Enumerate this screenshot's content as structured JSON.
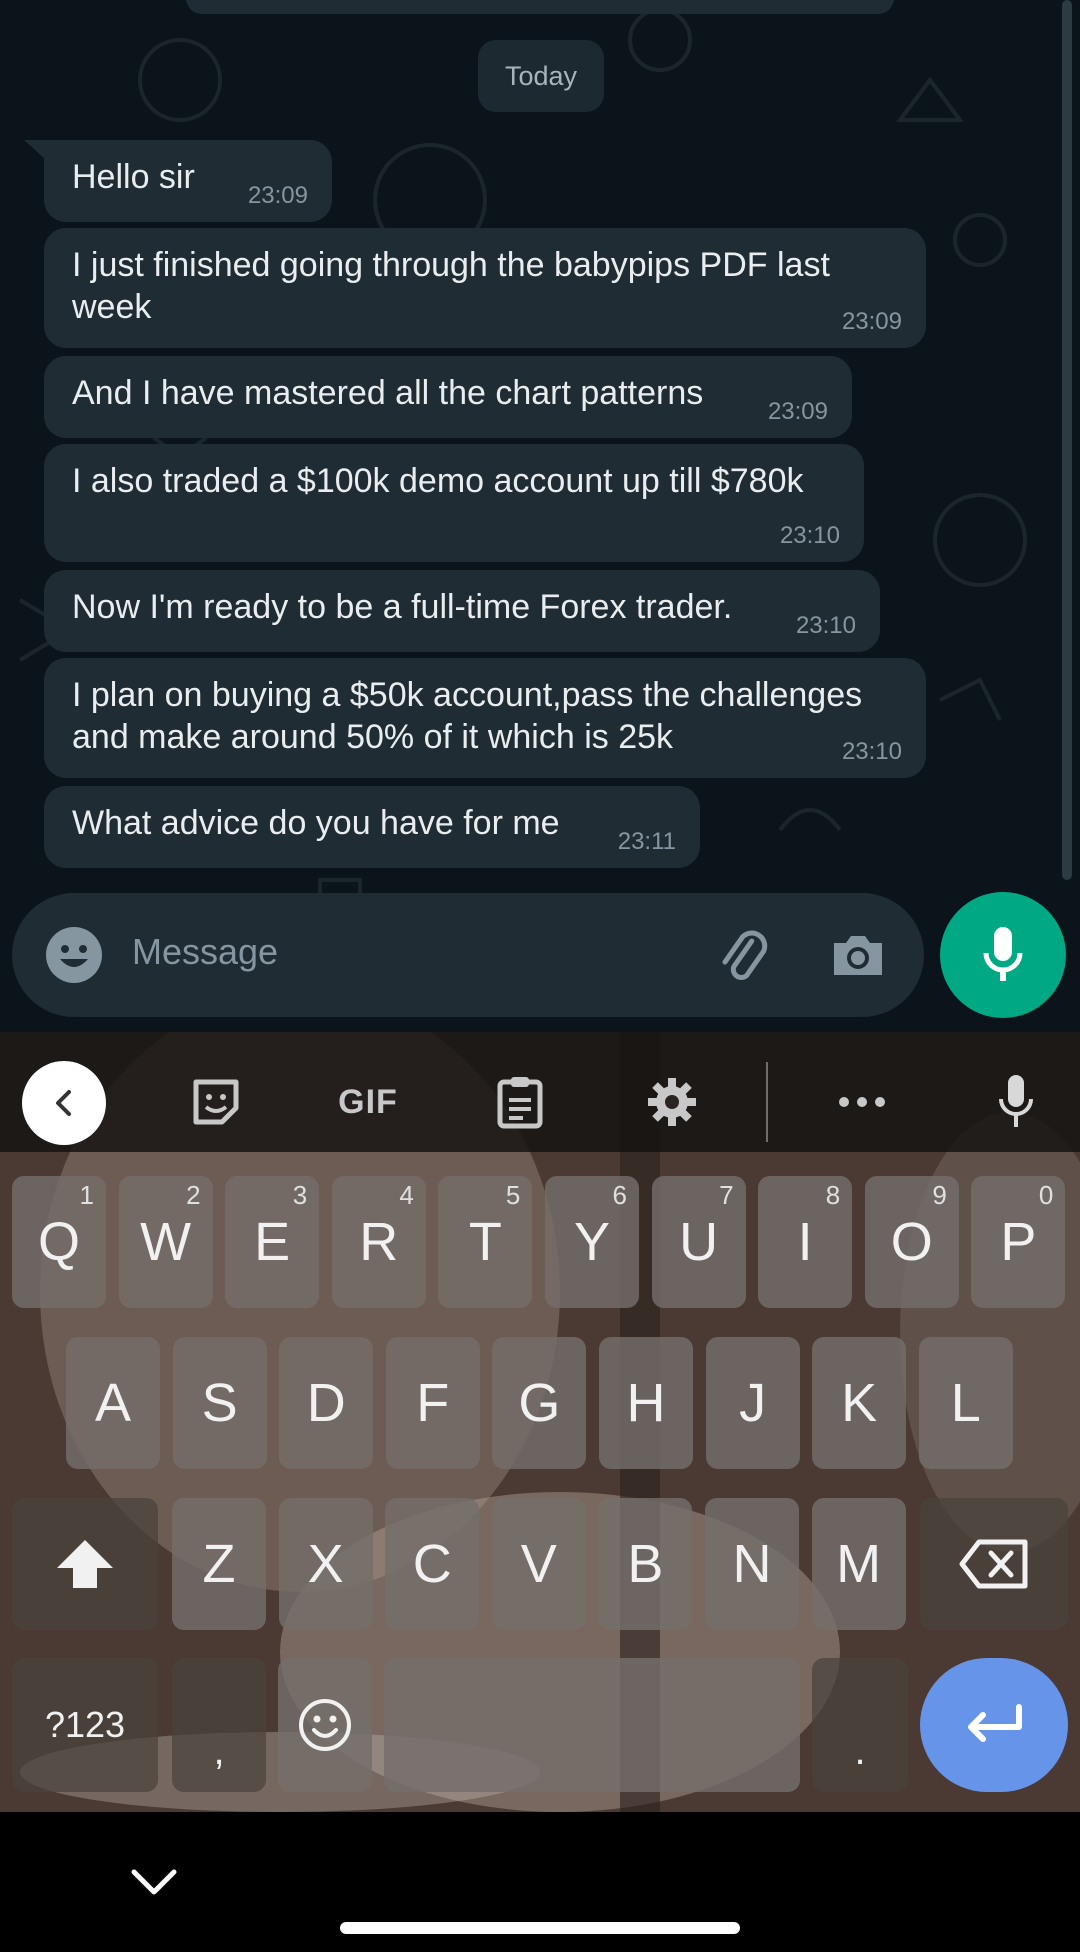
{
  "chat": {
    "date_chip": "Today",
    "messages": [
      {
        "text": "Hello sir",
        "time": "23:09"
      },
      {
        "text": "I just finished going through the babypips PDF last\nweek",
        "time": "23:09"
      },
      {
        "text": "And I have mastered all the chart patterns",
        "time": "23:09"
      },
      {
        "text": "I also traded a $100k demo account up till $780k",
        "time": "23:10"
      },
      {
        "text": "Now I'm ready to be a full-time Forex trader.",
        "time": "23:10"
      },
      {
        "text": "I plan on buying a $50k account,pass the challenges\nand make around 50% of it which is 25k",
        "time": "23:10"
      },
      {
        "text": "What advice do you have for me",
        "time": "23:11"
      }
    ]
  },
  "composer": {
    "placeholder": "Message",
    "icons": {
      "emoji": "smiley-icon",
      "attach": "paperclip-icon",
      "camera": "camera-icon",
      "mic": "microphone-icon"
    },
    "accent_color": "#00a884"
  },
  "keyboard": {
    "toolbar": {
      "back": "chevron-left-icon",
      "sticker": "sticker-icon",
      "gif": "GIF",
      "clipboard": "clipboard-icon",
      "settings": "gear-icon",
      "more": "more-horizontal-icon",
      "voice": "microphone-icon"
    },
    "row1": [
      "Q",
      "W",
      "E",
      "R",
      "T",
      "Y",
      "U",
      "I",
      "O",
      "P"
    ],
    "row1_numbers": [
      "1",
      "2",
      "3",
      "4",
      "5",
      "6",
      "7",
      "8",
      "9",
      "0"
    ],
    "row2": [
      "A",
      "S",
      "D",
      "F",
      "G",
      "H",
      "J",
      "K",
      "L"
    ],
    "row3": [
      "Z",
      "X",
      "C",
      "V",
      "B",
      "N",
      "M"
    ],
    "bottom": {
      "symbols": "?123",
      "comma": ",",
      "period": "."
    },
    "enter_color": "#6694e9"
  },
  "navbar": {
    "collapse": "chevron-down-icon"
  }
}
